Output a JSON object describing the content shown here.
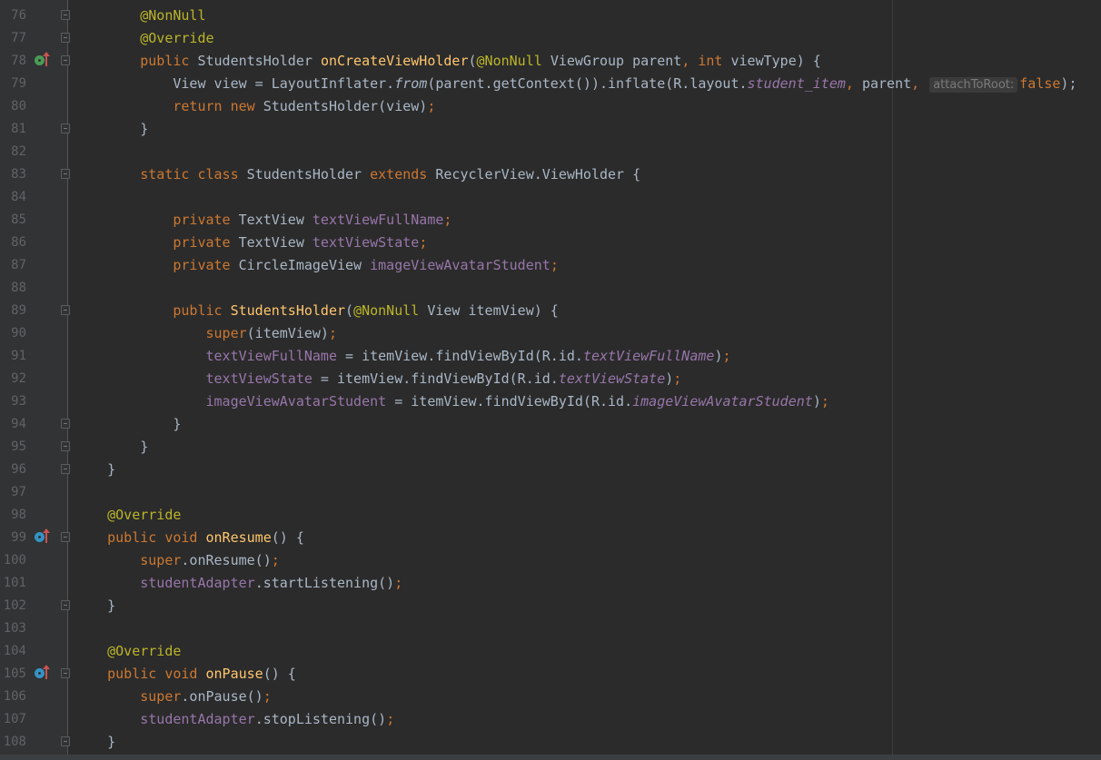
{
  "editor": {
    "lines": [
      {
        "num": "76",
        "fold": true,
        "tokens": [
          [
            "        ",
            "p"
          ],
          [
            "@NonNull",
            "ann"
          ]
        ]
      },
      {
        "num": "77",
        "fold": true,
        "tokens": [
          [
            "        ",
            "p"
          ],
          [
            "@Override",
            "ann"
          ]
        ]
      },
      {
        "num": "78",
        "fold": true,
        "gutter_icon": "implements-icon",
        "tokens": [
          [
            "        ",
            "p"
          ],
          [
            "public ",
            "kw"
          ],
          [
            "StudentsHolder ",
            "p"
          ],
          [
            "onCreateViewHolder",
            "mth"
          ],
          [
            "(",
            "p"
          ],
          [
            "@NonNull ",
            "ann"
          ],
          [
            "ViewGroup parent",
            "p"
          ],
          [
            ", ",
            "kw"
          ],
          [
            "int ",
            "kw"
          ],
          [
            "viewType) {",
            "p"
          ]
        ]
      },
      {
        "num": "79",
        "tokens": [
          [
            "            View view = LayoutInflater.",
            "p"
          ],
          [
            "from",
            "sti"
          ],
          [
            "(parent.getContext()).inflate(R.layout.",
            "p"
          ],
          [
            "student_item",
            "fldi"
          ],
          [
            ", ",
            "kw"
          ],
          [
            "parent",
            "p"
          ],
          [
            ", ",
            "kw"
          ],
          [
            "attachToRoot:",
            "hint"
          ],
          [
            "false",
            "kw"
          ],
          [
            ");",
            "p"
          ]
        ]
      },
      {
        "num": "80",
        "tokens": [
          [
            "            ",
            "p"
          ],
          [
            "return new ",
            "kw"
          ],
          [
            "StudentsHolder(view)",
            "p"
          ],
          [
            ";",
            "kw"
          ]
        ]
      },
      {
        "num": "81",
        "fold": true,
        "tokens": [
          [
            "        }",
            "p"
          ]
        ]
      },
      {
        "num": "82",
        "tokens": []
      },
      {
        "num": "83",
        "fold": true,
        "tokens": [
          [
            "        ",
            "p"
          ],
          [
            "static class ",
            "kw"
          ],
          [
            "StudentsHolder ",
            "p"
          ],
          [
            "extends ",
            "kw"
          ],
          [
            "RecyclerView.ViewHolder {",
            "p"
          ]
        ]
      },
      {
        "num": "84",
        "tokens": []
      },
      {
        "num": "85",
        "tokens": [
          [
            "            ",
            "p"
          ],
          [
            "private ",
            "kw"
          ],
          [
            "TextView ",
            "p"
          ],
          [
            "textViewFullName",
            "fld"
          ],
          [
            ";",
            "kw"
          ]
        ]
      },
      {
        "num": "86",
        "tokens": [
          [
            "            ",
            "p"
          ],
          [
            "private ",
            "kw"
          ],
          [
            "TextView ",
            "p"
          ],
          [
            "textViewState",
            "fld"
          ],
          [
            ";",
            "kw"
          ]
        ]
      },
      {
        "num": "87",
        "tokens": [
          [
            "            ",
            "p"
          ],
          [
            "private ",
            "kw"
          ],
          [
            "CircleImageView ",
            "p"
          ],
          [
            "imageViewAvatarStudent",
            "fld"
          ],
          [
            ";",
            "kw"
          ]
        ]
      },
      {
        "num": "88",
        "tokens": []
      },
      {
        "num": "89",
        "fold": true,
        "tokens": [
          [
            "            ",
            "p"
          ],
          [
            "public ",
            "kw"
          ],
          [
            "StudentsHolder",
            "mth"
          ],
          [
            "(",
            "p"
          ],
          [
            "@NonNull ",
            "ann"
          ],
          [
            "View itemView) {",
            "p"
          ]
        ]
      },
      {
        "num": "90",
        "tokens": [
          [
            "                ",
            "p"
          ],
          [
            "super",
            "kw"
          ],
          [
            "(itemView)",
            "p"
          ],
          [
            ";",
            "kw"
          ]
        ]
      },
      {
        "num": "91",
        "tokens": [
          [
            "                ",
            "p"
          ],
          [
            "textViewFullName",
            "fld"
          ],
          [
            " = itemView.findViewById(R.id.",
            "p"
          ],
          [
            "textViewFullName",
            "fldi"
          ],
          [
            ")",
            "p"
          ],
          [
            ";",
            "kw"
          ]
        ]
      },
      {
        "num": "92",
        "tokens": [
          [
            "                ",
            "p"
          ],
          [
            "textViewState",
            "fld"
          ],
          [
            " = itemView.findViewById(R.id.",
            "p"
          ],
          [
            "textViewState",
            "fldi"
          ],
          [
            ")",
            "p"
          ],
          [
            ";",
            "kw"
          ]
        ]
      },
      {
        "num": "93",
        "tokens": [
          [
            "                ",
            "p"
          ],
          [
            "imageViewAvatarStudent",
            "fld"
          ],
          [
            " = itemView.findViewById(R.id.",
            "p"
          ],
          [
            "imageViewAvatarStudent",
            "fldi"
          ],
          [
            ")",
            "p"
          ],
          [
            ";",
            "kw"
          ]
        ]
      },
      {
        "num": "94",
        "fold": true,
        "tokens": [
          [
            "            }",
            "p"
          ]
        ]
      },
      {
        "num": "95",
        "fold": true,
        "tokens": [
          [
            "        }",
            "p"
          ]
        ]
      },
      {
        "num": "96",
        "fold": true,
        "tokens": [
          [
            "    }",
            "p"
          ]
        ]
      },
      {
        "num": "97",
        "tokens": []
      },
      {
        "num": "98",
        "tokens": [
          [
            "    ",
            "p"
          ],
          [
            "@Override",
            "ann"
          ]
        ]
      },
      {
        "num": "99",
        "fold": true,
        "gutter_icon": "overrides-icon",
        "tokens": [
          [
            "    ",
            "p"
          ],
          [
            "public void ",
            "kw"
          ],
          [
            "onResume",
            "mth"
          ],
          [
            "() {",
            "p"
          ]
        ]
      },
      {
        "num": "100",
        "tokens": [
          [
            "        ",
            "p"
          ],
          [
            "super",
            "kw"
          ],
          [
            ".onResume()",
            "p"
          ],
          [
            ";",
            "kw"
          ]
        ]
      },
      {
        "num": "101",
        "tokens": [
          [
            "        ",
            "p"
          ],
          [
            "studentAdapter",
            "fld"
          ],
          [
            ".startListening()",
            "p"
          ],
          [
            ";",
            "kw"
          ]
        ]
      },
      {
        "num": "102",
        "fold": true,
        "tokens": [
          [
            "    }",
            "p"
          ]
        ]
      },
      {
        "num": "103",
        "tokens": []
      },
      {
        "num": "104",
        "tokens": [
          [
            "    ",
            "p"
          ],
          [
            "@Override",
            "ann"
          ]
        ]
      },
      {
        "num": "105",
        "fold": true,
        "gutter_icon": "overrides-icon",
        "tokens": [
          [
            "    ",
            "p"
          ],
          [
            "public void ",
            "kw"
          ],
          [
            "onPause",
            "mth"
          ],
          [
            "() {",
            "p"
          ]
        ]
      },
      {
        "num": "106",
        "tokens": [
          [
            "        ",
            "p"
          ],
          [
            "super",
            "kw"
          ],
          [
            ".onPause()",
            "p"
          ],
          [
            ";",
            "kw"
          ]
        ]
      },
      {
        "num": "107",
        "tokens": [
          [
            "        ",
            "p"
          ],
          [
            "studentAdapter",
            "fld"
          ],
          [
            ".stopListening()",
            "p"
          ],
          [
            ";",
            "kw"
          ]
        ]
      },
      {
        "num": "108",
        "fold": true,
        "tokens": [
          [
            "    }",
            "p"
          ]
        ]
      }
    ]
  }
}
